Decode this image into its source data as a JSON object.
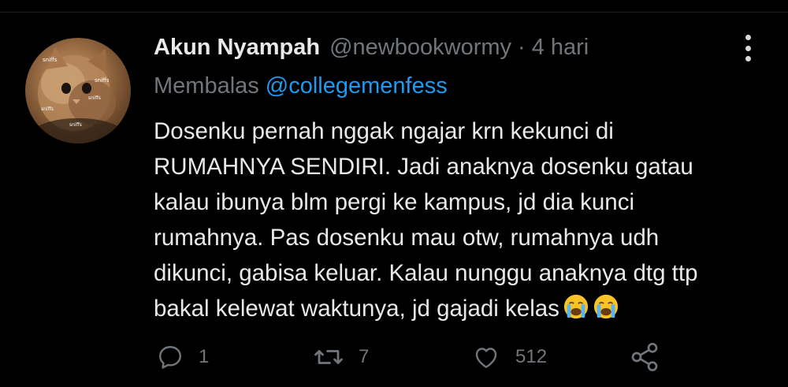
{
  "tweet": {
    "display_name": "Akun Nyampah",
    "handle": "@newbookwormy",
    "separator": "·",
    "time": "4 hari",
    "reply_prefix": "Membalas",
    "reply_mention": "@collegemenfess",
    "body_lines": [
      "Dosenku pernah nggak ngajar krn kekunci di",
      "RUMAHNYA SENDIRI. Jadi anaknya dosenku gatau",
      "kalau ibunya blm pergi ke kampus, jd dia kunci",
      "rumahnya. Pas dosenku mau otw, rumahnya udh",
      "dikunci, gabisa keluar. Kalau nunggu anaknya dtg ttp",
      "bakal kelewat waktunya, jd gajadi kelas"
    ],
    "emojis": [
      "loudly-crying-face-emoji",
      "loudly-crying-face-emoji"
    ],
    "avatar_overlay_text": [
      "sniffs",
      "sniffs",
      "sniffs",
      "sniffs",
      "sniffs"
    ]
  },
  "actions": {
    "reply_count": "1",
    "retweet_count": "7",
    "like_count": "512"
  },
  "icons": {
    "reply": "reply-icon",
    "retweet": "retweet-icon",
    "like": "heart-icon",
    "share": "share-icon",
    "more": "more-vertical-icon"
  },
  "colors": {
    "background": "#000000",
    "primary_text": "#e7e9ea",
    "secondary_text": "#71767b",
    "mention": "#1d9bf0"
  }
}
